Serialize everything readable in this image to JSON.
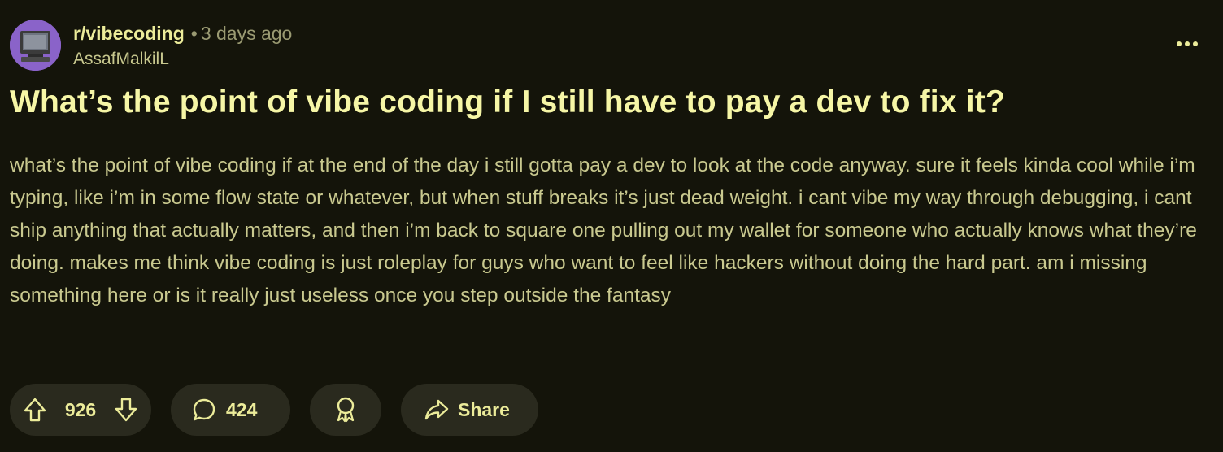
{
  "post": {
    "subreddit": "r/vibecoding",
    "separator": "•",
    "time": "3 days ago",
    "author": "AssafMalkilL",
    "title": "What’s the point of vibe coding if I still have to pay a dev to fix it?",
    "body": "what’s the point of vibe coding if at the end of the day i still gotta pay a dev to look at the code anyway. sure it feels kinda cool while i’m typing, like i’m in some flow state or whatever, but when stuff breaks it’s just dead weight. i cant vibe my way through debugging, i cant ship anything that actually matters, and then i’m back to square one pulling out my wallet for someone who actually knows what they’re doing. makes me think vibe coding is just roleplay for guys who want to feel like hackers without doing the hard part. am i missing something here or is it really just useless once you step outside the fantasy"
  },
  "actions": {
    "score": "926",
    "comments": "424",
    "share_label": "Share"
  },
  "icons": {
    "avatar": "retro-computer-avatar",
    "more": "more-options-icon",
    "upvote": "upvote-arrow-icon",
    "downvote": "downvote-arrow-icon",
    "comment": "comment-bubble-icon",
    "award": "award-ribbon-icon",
    "share": "share-arrow-icon"
  },
  "colors": {
    "background": "#14140a",
    "title": "#f6f6a6",
    "body": "#c9c98f",
    "pill": "#2a2a1e",
    "accent": "#ecec9a"
  }
}
